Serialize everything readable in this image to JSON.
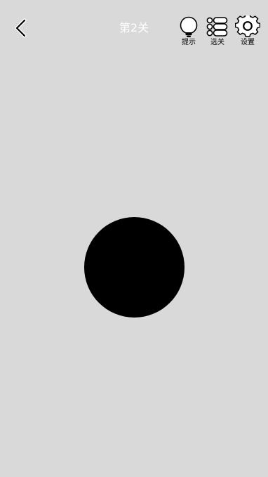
{
  "header": {
    "title": "第2关",
    "back_icon": "back-chevron-icon",
    "tools": [
      {
        "label": "提示",
        "icon": "lightbulb-icon"
      },
      {
        "label": "选关",
        "icon": "level-list-icon"
      },
      {
        "label": "设置",
        "icon": "gear-icon"
      }
    ]
  },
  "game": {
    "shape": "circle",
    "color": "#000000",
    "background": "#d9d9d9"
  }
}
